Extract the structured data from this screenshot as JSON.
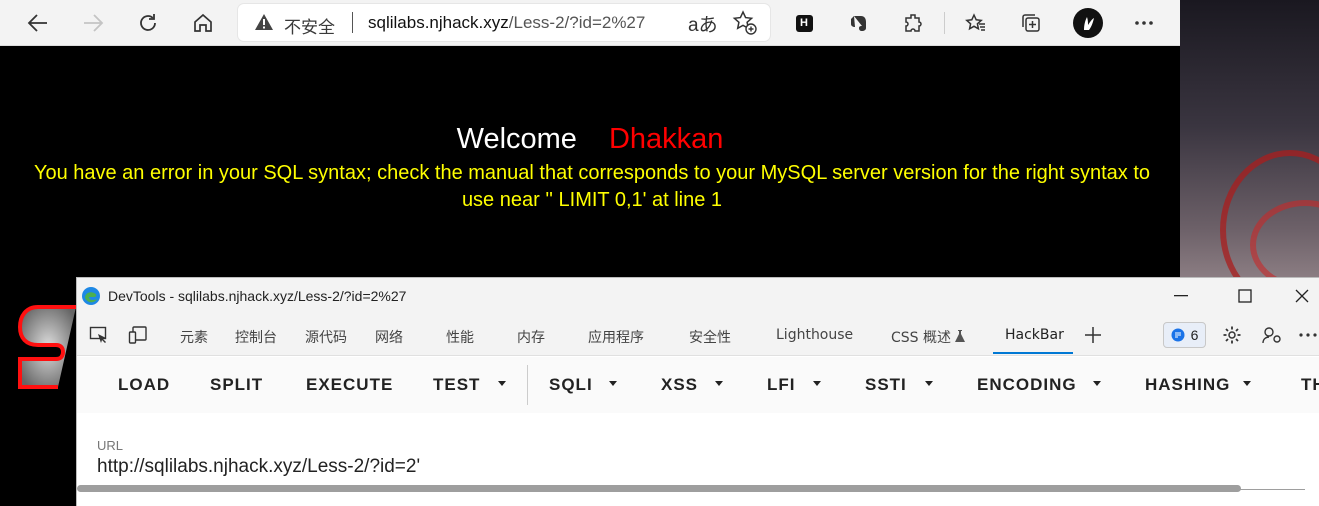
{
  "browser": {
    "security_label": "不安全",
    "url_host": "sqlilabs.njhack.xyz",
    "url_path": "/Less-2/?id=2%27",
    "read_aloud_glyph": "aあ",
    "toolbar_icons": [
      "back-icon",
      "forward-icon",
      "refresh-icon",
      "home-icon",
      "warning-icon",
      "read-aloud-icon",
      "add-favorite-icon",
      "hackbar-extension-icon",
      "evernote-icon",
      "extensions-icon",
      "favorites-icon",
      "collections-icon",
      "profile-avatar-icon",
      "more-icon"
    ],
    "hackbar_ext_letter": "H"
  },
  "page": {
    "welcome": "Welcome",
    "username": "Dhakkan",
    "sql_error": "You have an error in your SQL syntax; check the manual that corresponds to your MySQL server version for the right syntax to use near '' LIMIT 0,1' at line 1"
  },
  "devtools": {
    "window_title": "DevTools - sqlilabs.njhack.xyz/Less-2/?id=2%27",
    "tabs": [
      "元素",
      "控制台",
      "源代码",
      "网络",
      "性能",
      "内存",
      "应用程序",
      "安全性",
      "Lighthouse",
      "CSS 概述",
      "HackBar"
    ],
    "active_tab": "HackBar",
    "issues_count": "6",
    "window_controls": [
      "minimize-icon",
      "maximize-icon",
      "close-icon"
    ]
  },
  "hackbar": {
    "buttons": [
      "LOAD",
      "SPLIT",
      "EXECUTE",
      "TEST",
      "SQLI",
      "XSS",
      "LFI",
      "SSTI",
      "ENCODING",
      "HASHING",
      "TH"
    ],
    "url_label": "URL",
    "url_value": "http://sqlilabs.njhack.xyz/Less-2/?id=2'"
  },
  "colors": {
    "welcome": "#ffffff",
    "username": "#ff0000",
    "error_text": "#ffff00",
    "accent": "#0078d4"
  }
}
